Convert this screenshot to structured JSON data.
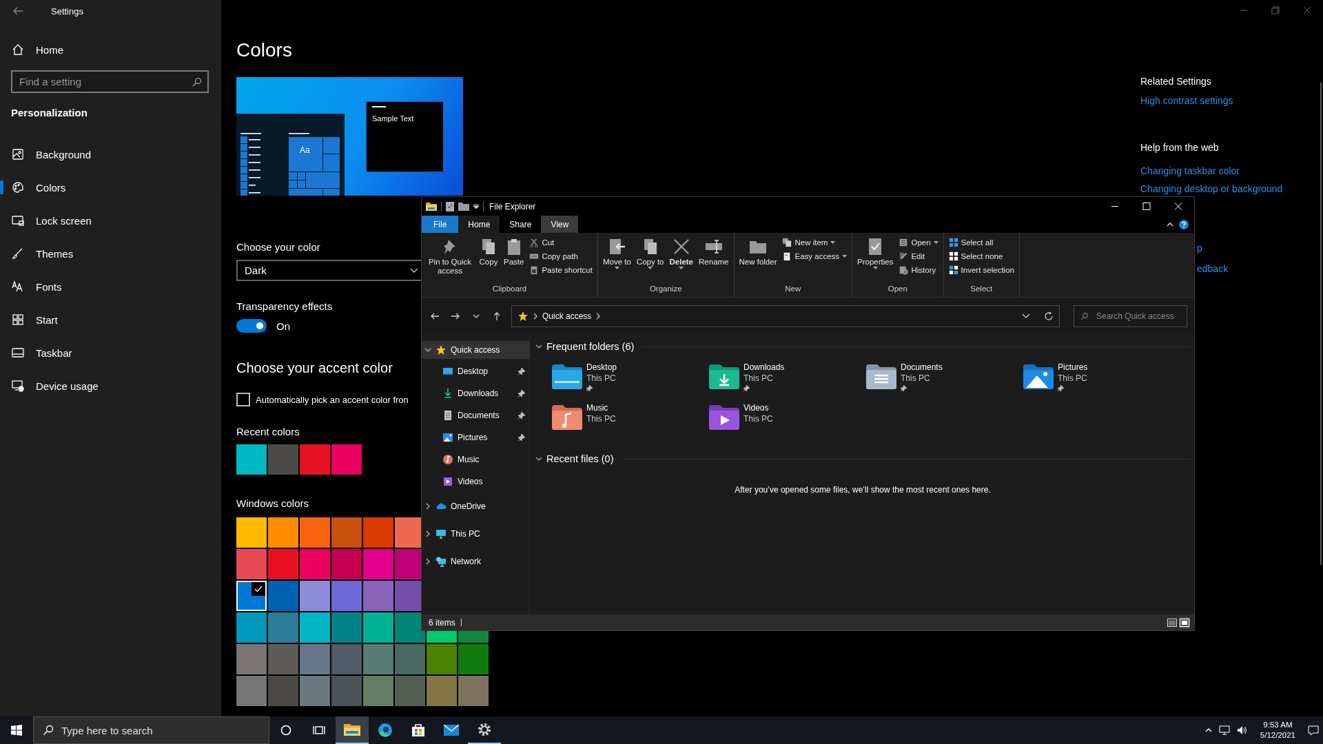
{
  "settings": {
    "title": "Settings",
    "home": "Home",
    "search": {
      "placeholder": "Find a setting"
    },
    "section": "Personalization",
    "nav": [
      {
        "label": "Background",
        "kind": "background",
        "selected": false
      },
      {
        "label": "Colors",
        "kind": "colors",
        "selected": true
      },
      {
        "label": "Lock screen",
        "kind": "lock",
        "selected": false
      },
      {
        "label": "Themes",
        "kind": "themes",
        "selected": false
      },
      {
        "label": "Fonts",
        "kind": "fonts",
        "selected": false
      },
      {
        "label": "Start",
        "kind": "start",
        "selected": false
      },
      {
        "label": "Taskbar",
        "kind": "taskbar",
        "selected": false
      },
      {
        "label": "Device usage",
        "kind": "device",
        "selected": false
      }
    ],
    "page_title": "Colors",
    "preview": {
      "tile_text": "Aa",
      "sample_text": "Sample Text"
    },
    "color_mode": {
      "label": "Choose your color",
      "value": "Dark"
    },
    "transparency": {
      "label": "Transparency effects",
      "on": true,
      "state_text": "On"
    },
    "accent_heading": "Choose your accent color",
    "auto_pick": {
      "label": "Automatically pick an accent color fron",
      "checked": false
    },
    "recent_colors": {
      "label": "Recent colors",
      "swatches": [
        {
          "color": "#00b7c3"
        },
        {
          "color": "#4c4a48"
        },
        {
          "color": "#e81123"
        },
        {
          "color": "#ea005e"
        }
      ]
    },
    "windows_colors": {
      "label": "Windows colors",
      "rows": [
        [
          {
            "color": "#ffb900",
            "selected": false
          },
          {
            "color": "#ff8c00",
            "selected": false
          },
          {
            "color": "#f7630c",
            "selected": false
          },
          {
            "color": "#ca5010",
            "selected": false
          },
          {
            "color": "#da3b01",
            "selected": false
          },
          {
            "color": "#ef6950",
            "selected": false
          }
        ],
        [
          {
            "color": "#e74856",
            "selected": false
          },
          {
            "color": "#e81123",
            "selected": false
          },
          {
            "color": "#ea005e",
            "selected": false
          },
          {
            "color": "#c30052",
            "selected": false
          },
          {
            "color": "#e3008c",
            "selected": false
          },
          {
            "color": "#bf0077",
            "selected": false
          }
        ],
        [
          {
            "color": "#0078d7",
            "selected": true
          },
          {
            "color": "#0063b1",
            "selected": false
          },
          {
            "color": "#8e8cd8",
            "selected": false
          },
          {
            "color": "#6b69d6",
            "selected": false
          },
          {
            "color": "#8764b8",
            "selected": false
          },
          {
            "color": "#744da9",
            "selected": false
          }
        ],
        [
          {
            "color": "#0099bc",
            "selected": false
          },
          {
            "color": "#2d7d9a",
            "selected": false
          },
          {
            "color": "#00b7c3",
            "selected": false
          },
          {
            "color": "#038387",
            "selected": false
          },
          {
            "color": "#00b294",
            "selected": false
          },
          {
            "color": "#018574",
            "selected": false
          },
          {
            "color": "#00cc6a",
            "selected": false
          },
          {
            "color": "#10893e",
            "selected": false
          }
        ],
        [
          {
            "color": "#7a7574",
            "selected": false
          },
          {
            "color": "#5d5a58",
            "selected": false
          },
          {
            "color": "#68768a",
            "selected": false
          },
          {
            "color": "#515c6b",
            "selected": false
          },
          {
            "color": "#567c73",
            "selected": false
          },
          {
            "color": "#486860",
            "selected": false
          },
          {
            "color": "#498205",
            "selected": false
          },
          {
            "color": "#107c10",
            "selected": false
          }
        ],
        [
          {
            "color": "#767676",
            "selected": false
          },
          {
            "color": "#4c4a48",
            "selected": false
          },
          {
            "color": "#69797e",
            "selected": false
          },
          {
            "color": "#4a5459",
            "selected": false
          },
          {
            "color": "#647c64",
            "selected": false
          },
          {
            "color": "#525e54",
            "selected": false
          },
          {
            "color": "#847545",
            "selected": false
          },
          {
            "color": "#7e735f",
            "selected": false
          }
        ]
      ]
    },
    "related": {
      "heading": "Related Settings",
      "links": [
        "High contrast settings"
      ]
    },
    "help": {
      "heading": "Help from the web",
      "links": [
        "Changing taskbar color",
        "Changing desktop or background"
      ]
    },
    "partial_links": [
      "p",
      "edback"
    ]
  },
  "explorer": {
    "title": "File Explorer",
    "tabs": [
      {
        "label": "File",
        "kind": "file",
        "selected": false,
        "hover": false
      },
      {
        "label": "Home",
        "kind": "tab",
        "selected": true,
        "hover": false
      },
      {
        "label": "Share",
        "kind": "tab",
        "selected": false,
        "hover": false
      },
      {
        "label": "View",
        "kind": "tab",
        "selected": false,
        "hover": true
      }
    ],
    "groups": [
      {
        "label": "Clipboard",
        "items": [
          {
            "label": "Pin to Quick access",
            "kind": "large",
            "dropdown": false,
            "bold": false
          },
          {
            "label": "Copy",
            "kind": "large",
            "dropdown": false,
            "bold": false
          },
          {
            "label": "Paste",
            "kind": "large",
            "dropdown": false,
            "bold": false
          },
          {
            "label": "Cut",
            "kind": "small",
            "dropdown": false,
            "bold": false
          },
          {
            "label": "Copy path",
            "kind": "small",
            "dropdown": false,
            "bold": false
          },
          {
            "label": "Paste shortcut",
            "kind": "small",
            "dropdown": false,
            "bold": false
          }
        ]
      },
      {
        "label": "Organize",
        "items": [
          {
            "label": "Move to",
            "kind": "large",
            "dropdown": true,
            "bold": false
          },
          {
            "label": "Copy to",
            "kind": "large",
            "dropdown": true,
            "bold": false
          },
          {
            "label": "Delete",
            "kind": "large",
            "dropdown": true,
            "bold": true
          },
          {
            "label": "Rename",
            "kind": "large",
            "dropdown": false,
            "bold": false
          }
        ]
      },
      {
        "label": "New",
        "items": [
          {
            "label": "New folder",
            "kind": "large",
            "dropdown": false,
            "bold": false
          },
          {
            "label": "New item",
            "kind": "small",
            "dropdown": true,
            "bold": false
          },
          {
            "label": "Easy access",
            "kind": "small",
            "dropdown": true,
            "bold": false
          }
        ]
      },
      {
        "label": "Open",
        "items": [
          {
            "label": "Properties",
            "kind": "large",
            "dropdown": true,
            "bold": false
          },
          {
            "label": "Open",
            "kind": "small",
            "dropdown": true,
            "bold": false
          },
          {
            "label": "Edit",
            "kind": "small",
            "dropdown": false,
            "bold": false
          },
          {
            "label": "History",
            "kind": "small",
            "dropdown": false,
            "bold": false
          }
        ]
      },
      {
        "label": "Select",
        "items": [
          {
            "label": "Select all",
            "kind": "small",
            "dropdown": false,
            "bold": false
          },
          {
            "label": "Select none",
            "kind": "small",
            "dropdown": false,
            "bold": false
          },
          {
            "label": "Invert selection",
            "kind": "small",
            "dropdown": false,
            "bold": false
          }
        ]
      }
    ],
    "address": {
      "path": "Quick access"
    },
    "search": {
      "placeholder": "Search Quick access"
    },
    "tree": [
      {
        "label": "Quick access",
        "kind": "star",
        "expanded": true,
        "selected": true,
        "children": [
          {
            "label": "Desktop",
            "kind": "desktop",
            "pinned": true
          },
          {
            "label": "Downloads",
            "kind": "downloads",
            "pinned": true
          },
          {
            "label": "Documents",
            "kind": "documents",
            "pinned": true
          },
          {
            "label": "Pictures",
            "kind": "pictures",
            "pinned": true
          },
          {
            "label": "Music",
            "kind": "music",
            "pinned": false
          },
          {
            "label": "Videos",
            "kind": "videos",
            "pinned": false
          }
        ]
      },
      {
        "label": "OneDrive",
        "kind": "cloud",
        "expanded": false,
        "selected": false
      },
      {
        "label": "This PC",
        "kind": "pc",
        "expanded": false,
        "selected": false
      },
      {
        "label": "Network",
        "kind": "network",
        "expanded": false,
        "selected": false
      }
    ],
    "frequent": {
      "heading": "Frequent folders (6)",
      "expanded": true,
      "folders": [
        {
          "name": "Desktop",
          "location": "This PC",
          "kind": "desktop",
          "pinned": true
        },
        {
          "name": "Downloads",
          "location": "This PC",
          "kind": "downloads",
          "pinned": true
        },
        {
          "name": "Documents",
          "location": "This PC",
          "kind": "documents",
          "pinned": true
        },
        {
          "name": "Pictures",
          "location": "This PC",
          "kind": "pictures",
          "pinned": true
        },
        {
          "name": "Music",
          "location": "This PC",
          "kind": "music",
          "pinned": false
        },
        {
          "name": "Videos",
          "location": "This PC",
          "kind": "videos",
          "pinned": false
        }
      ]
    },
    "recent": {
      "heading": "Recent files (0)",
      "expanded": true,
      "message": "After you’ve opened some files, we’ll show the most recent ones here."
    },
    "status": {
      "count": "6 items",
      "views": [
        {
          "kind": "details",
          "selected": false
        },
        {
          "kind": "large",
          "selected": true
        }
      ]
    }
  },
  "taskbar": {
    "search": {
      "placeholder": "Type here to search"
    },
    "apps": [
      {
        "kind": "cortana",
        "active": false,
        "running": false
      },
      {
        "kind": "taskview",
        "active": false,
        "running": false
      },
      {
        "kind": "explorer",
        "active": true,
        "running": true
      },
      {
        "kind": "edge",
        "active": false,
        "running": false
      },
      {
        "kind": "store",
        "active": false,
        "running": false
      },
      {
        "kind": "mail",
        "active": false,
        "running": false
      },
      {
        "kind": "settings",
        "active": false,
        "running": true
      }
    ],
    "time": "9:53 AM",
    "date": "5/12/2021"
  }
}
